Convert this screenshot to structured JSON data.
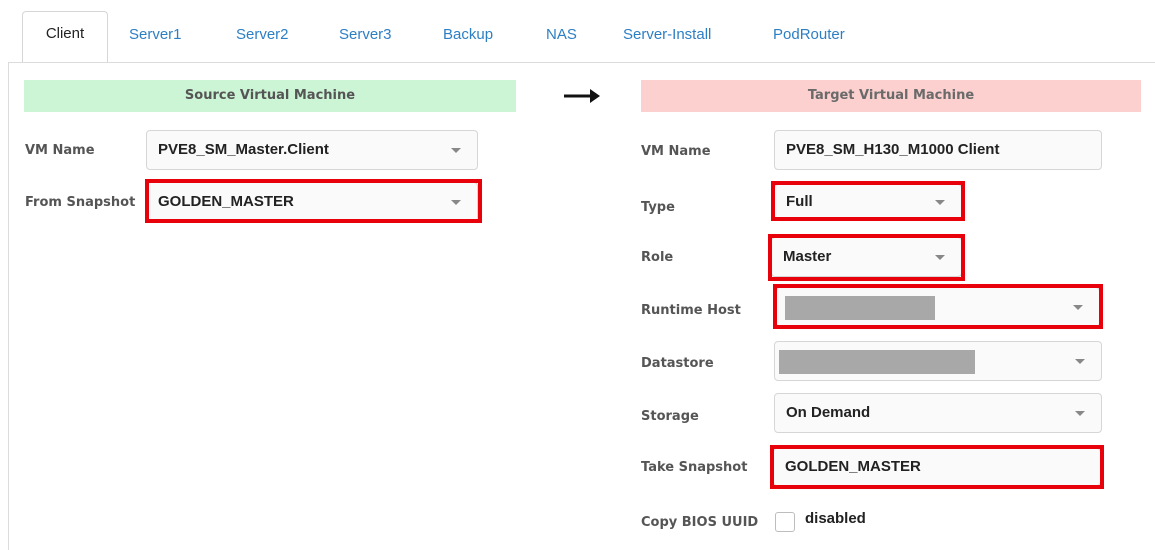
{
  "tabs": [
    {
      "label": "Client",
      "active": true
    },
    {
      "label": "Server1"
    },
    {
      "label": "Server2"
    },
    {
      "label": "Server3"
    },
    {
      "label": "Backup"
    },
    {
      "label": "NAS"
    },
    {
      "label": "Server-Install"
    },
    {
      "label": "PodRouter"
    }
  ],
  "source": {
    "header": "Source Virtual Machine",
    "vm_name_label": "VM Name",
    "vm_name_value": "PVE8_SM_Master.Client",
    "snapshot_label": "From Snapshot",
    "snapshot_value": "GOLDEN_MASTER"
  },
  "arrow_icon": "right-arrow-icon",
  "target": {
    "header": "Target Virtual Machine",
    "vm_name_label": "VM Name",
    "vm_name_value": "PVE8_SM_H130_M1000 Client",
    "type_label": "Type",
    "type_value": "Full",
    "role_label": "Role",
    "role_value": "Master",
    "runtime_host_label": "Runtime Host",
    "datastore_label": "Datastore",
    "storage_label": "Storage",
    "storage_value": "On Demand",
    "take_snapshot_label": "Take Snapshot",
    "take_snapshot_value": "GOLDEN_MASTER",
    "copy_bios_label": "Copy BIOS UUID",
    "copy_bios_value": "disabled",
    "copy_bios_checked": false
  },
  "colors": {
    "source_header_bg": "#ccf5d6",
    "target_header_bg": "#fbd0cf",
    "tab_link": "#2d7fc4",
    "highlight": "#e8000b"
  }
}
